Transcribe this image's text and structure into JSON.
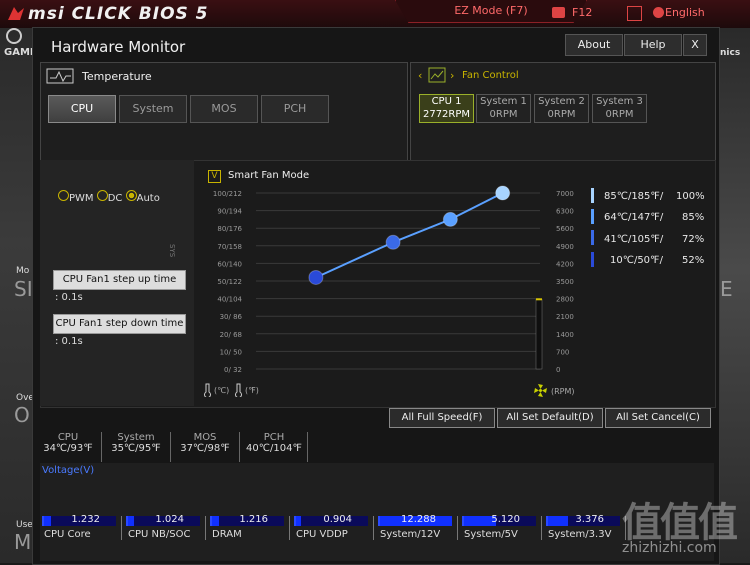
{
  "bios": {
    "brand": "msi CLICK BIOS 5",
    "ez_mode": "EZ Mode (F7)",
    "f12": "F12",
    "language": "English",
    "bg_text": {
      "gam": "GAMI",
      "mo": "Mo",
      "si": "SI",
      "ove": "Ove",
      "o": "O",
      "use": "Use",
      "m": "M",
      "nics": "nics",
      "e": "E"
    }
  },
  "window": {
    "title": "Hardware Monitor",
    "about_label": "About",
    "help_label": "Help",
    "close_label": "X"
  },
  "temperature": {
    "title": "Temperature",
    "tabs": [
      "CPU",
      "System",
      "MOS",
      "PCH"
    ],
    "active_tab": "CPU"
  },
  "fan_control": {
    "title": "Fan Control",
    "fans": [
      {
        "name": "CPU 1",
        "rpm": "2772RPM"
      },
      {
        "name": "System 1",
        "rpm": "0RPM"
      },
      {
        "name": "System 2",
        "rpm": "0RPM"
      },
      {
        "name": "System 3",
        "rpm": "0RPM"
      }
    ],
    "active_fan": "CPU 1"
  },
  "controls": {
    "mode_pwm": "PWM",
    "mode_dc": "DC",
    "mode_auto": "Auto",
    "selected_mode": "Auto",
    "step_up_label": "CPU Fan1 step up time",
    "step_up_value": ": 0.1s",
    "step_down_label": "CPU Fan1 step down time",
    "step_down_value": ": 0.1s",
    "smart_fan_label": "Smart Fan Mode",
    "smart_fan_checked": true,
    "check_mark": "V",
    "side_text": "SYS"
  },
  "chart_data": {
    "type": "line",
    "temp_ticks": [
      "100/212",
      "90/194",
      "80/176",
      "70/158",
      "60/140",
      "50/122",
      "40/104",
      "30/ 86",
      "20/ 68",
      "10/ 50",
      "0/ 32"
    ],
    "rpm_ticks": [
      "7000",
      "6300",
      "5600",
      "4900",
      "4200",
      "3500",
      "2800",
      "2100",
      "1400",
      "700",
      "0"
    ],
    "x_axis_label_c": "(℃)",
    "x_axis_label_f": "(℉)",
    "rpm_axis_label": "(RPM)",
    "points": [
      {
        "temp_c": 10,
        "fan_pct": 52
      },
      {
        "temp_c": 41,
        "fan_pct": 72
      },
      {
        "temp_c": 64,
        "fan_pct": 85
      },
      {
        "temp_c": 85,
        "fan_pct": 100
      }
    ],
    "current_rpm": 2772,
    "colors": {
      "line": "#5aa0ff",
      "point1": "#2a4ad8",
      "point2": "#3a6ae8",
      "point3": "#5aa0ff",
      "point4": "#a8d4ff",
      "level": "#d8c400"
    }
  },
  "legend": [
    {
      "temp": "85℃/185℉/",
      "pct": "100%",
      "color": "#a8d4ff"
    },
    {
      "temp": "64℃/147℉/",
      "pct": "85%",
      "color": "#5aa0ff"
    },
    {
      "temp": "41℃/105℉/",
      "pct": "72%",
      "color": "#3a6ae8"
    },
    {
      "temp": "10℃/50℉/",
      "pct": "52%",
      "color": "#2a4ad8"
    }
  ],
  "actions": {
    "full_speed": "All Full Speed(F)",
    "set_default": "All Set Default(D)",
    "set_cancel": "All Set Cancel(C)"
  },
  "temps": [
    {
      "label": "CPU",
      "value": "34℃/93℉"
    },
    {
      "label": "System",
      "value": "35℃/95℉"
    },
    {
      "label": "MOS",
      "value": "37℃/98℉"
    },
    {
      "label": "PCH",
      "value": "40℃/104℉"
    }
  ],
  "voltage": {
    "title": "Voltage(V)",
    "items": [
      {
        "name": "CPU Core",
        "value": "1.232",
        "fill": 0.1
      },
      {
        "name": "CPU NB/SOC",
        "value": "1.024",
        "fill": 0.08
      },
      {
        "name": "DRAM",
        "value": "1.216",
        "fill": 0.1
      },
      {
        "name": "CPU VDDP",
        "value": "0.904",
        "fill": 0.07
      },
      {
        "name": "System/12V",
        "value": "12.288",
        "fill": 1.0
      },
      {
        "name": "System/5V",
        "value": "5.120",
        "fill": 0.45
      },
      {
        "name": "System/3.3V",
        "value": "3.376",
        "fill": 0.28
      }
    ]
  },
  "watermark": {
    "main": "值值值",
    "sub": "zhizhizhi.com"
  }
}
